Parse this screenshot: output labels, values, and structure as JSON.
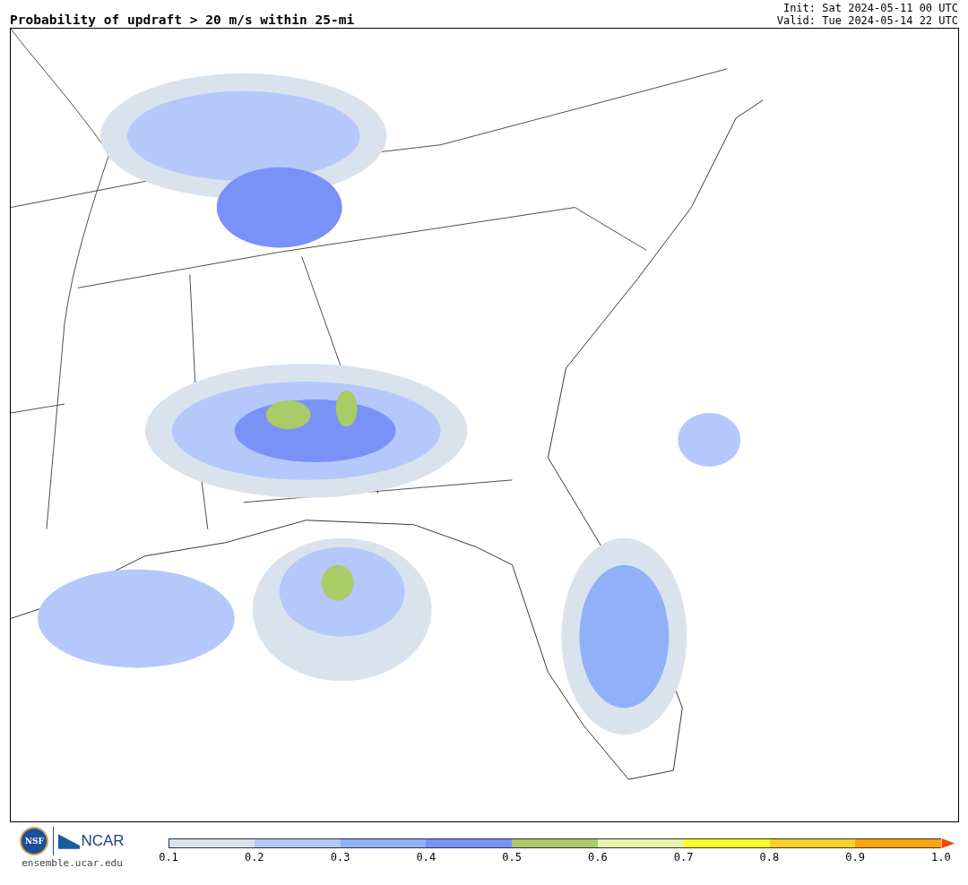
{
  "title": "Probability of updraft > 20 m/s within 25-mi",
  "init": "Init: Sat 2024-05-11 00 UTC",
  "valid": "Valid: Tue 2024-05-14 22 UTC",
  "logos": {
    "nsf": "NSF",
    "ncar": "NCAR",
    "site": "ensemble.ucar.edu"
  },
  "colorbar": {
    "segments": [
      {
        "kind": "box",
        "color": "#d9e3ee"
      },
      {
        "kind": "box",
        "color": "#b4c8fb"
      },
      {
        "kind": "box",
        "color": "#91b0fa"
      },
      {
        "kind": "box",
        "color": "#7a91f8"
      },
      {
        "kind": "box",
        "color": "#a8cc66"
      },
      {
        "kind": "box",
        "color": "#e6f5a8"
      },
      {
        "kind": "box",
        "color": "#ffff28"
      },
      {
        "kind": "box",
        "color": "#ffd128"
      },
      {
        "kind": "box",
        "color": "#ffa40a"
      },
      {
        "kind": "extension",
        "color": "#ea4b0c"
      }
    ],
    "ticks": [
      "0.1",
      "0.2",
      "0.3",
      "0.4",
      "0.5",
      "0.6",
      "0.7",
      "0.8",
      "0.9",
      "1.0"
    ]
  }
}
